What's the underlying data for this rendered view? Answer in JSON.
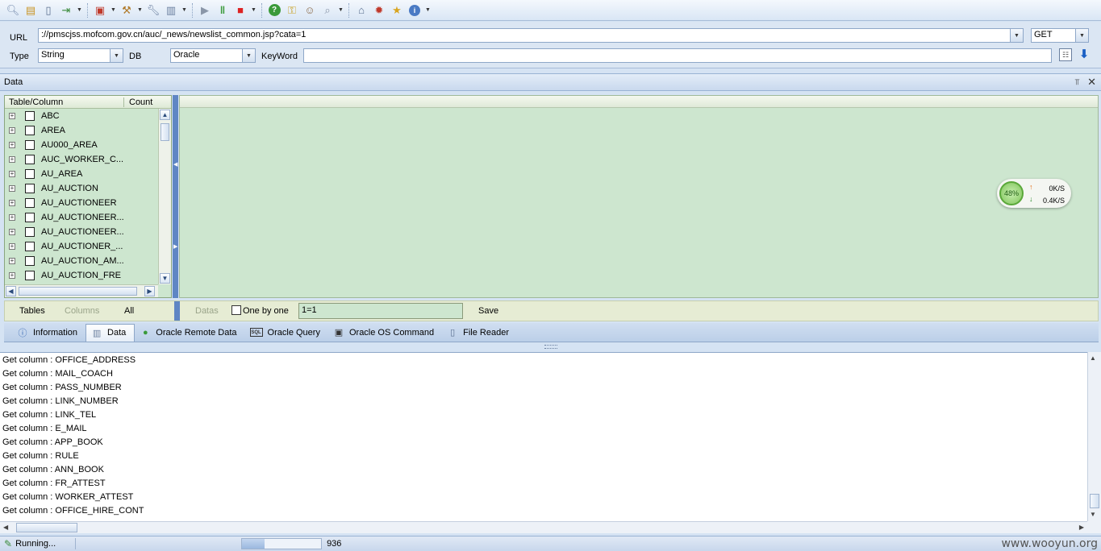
{
  "url_panel": {
    "url_label": "URL",
    "url_value": "://pmscjss.mofcom.gov.cn/auc/_news/newslist_common.jsp?cata=1",
    "method": "GET",
    "type_label": "Type",
    "type_value": "String",
    "db_label": "DB",
    "db_value": "Oracle",
    "keyword_label": "KeyWord",
    "keyword_value": ""
  },
  "data_panel": {
    "title": "Data",
    "tree": {
      "col_table": "Table/Column",
      "col_count": "Count",
      "items": [
        {
          "label": "ABC"
        },
        {
          "label": "AREA"
        },
        {
          "label": "AU000_AREA"
        },
        {
          "label": "AUC_WORKER_C..."
        },
        {
          "label": "AU_AREA"
        },
        {
          "label": "AU_AUCTION"
        },
        {
          "label": "AU_AUCTIONEER"
        },
        {
          "label": "AU_AUCTIONEER..."
        },
        {
          "label": "AU_AUCTIONEER..."
        },
        {
          "label": "AU_AUCTIONER_..."
        },
        {
          "label": "AU_AUCTION_AM..."
        },
        {
          "label": "AU_AUCTION_FRE"
        }
      ]
    },
    "speed": {
      "percent": "48%",
      "up": "0K/S",
      "down": "0.4K/S"
    },
    "bottom": {
      "tables": "Tables",
      "columns": "Columns",
      "all": "All",
      "datas": "Datas",
      "one_by_one": "One by one",
      "where_value": "1=1",
      "save": "Save"
    }
  },
  "tabs": [
    {
      "label": "Information",
      "icon": "info-icon"
    },
    {
      "label": "Data",
      "icon": "database-icon"
    },
    {
      "label": "Oracle Remote Data",
      "icon": "globe-icon"
    },
    {
      "label": "Oracle Query",
      "icon": "sql-icon"
    },
    {
      "label": "Oracle OS Command",
      "icon": "terminal-icon"
    },
    {
      "label": "File Reader",
      "icon": "file-icon"
    }
  ],
  "log": [
    "Get column : OFFICE_ADDRESS",
    "Get column : MAIL_COACH",
    "Get column : PASS_NUMBER",
    "Get column : LINK_NUMBER",
    "Get column : LINK_TEL",
    "Get column : E_MAIL",
    "Get column : APP_BOOK",
    "Get column : RULE",
    "Get column : ANN_BOOK",
    "Get column : FR_ATTEST",
    "Get column : WORKER_ATTEST",
    "Get column : OFFICE_HIRE_CONT"
  ],
  "status": {
    "running": "Running...",
    "progress_fraction": 0.28,
    "count": "936",
    "watermark": "www.wooyun.org"
  },
  "colors": {
    "panel_green": "#cde6cf",
    "splitter_blue": "#5f86c4"
  }
}
